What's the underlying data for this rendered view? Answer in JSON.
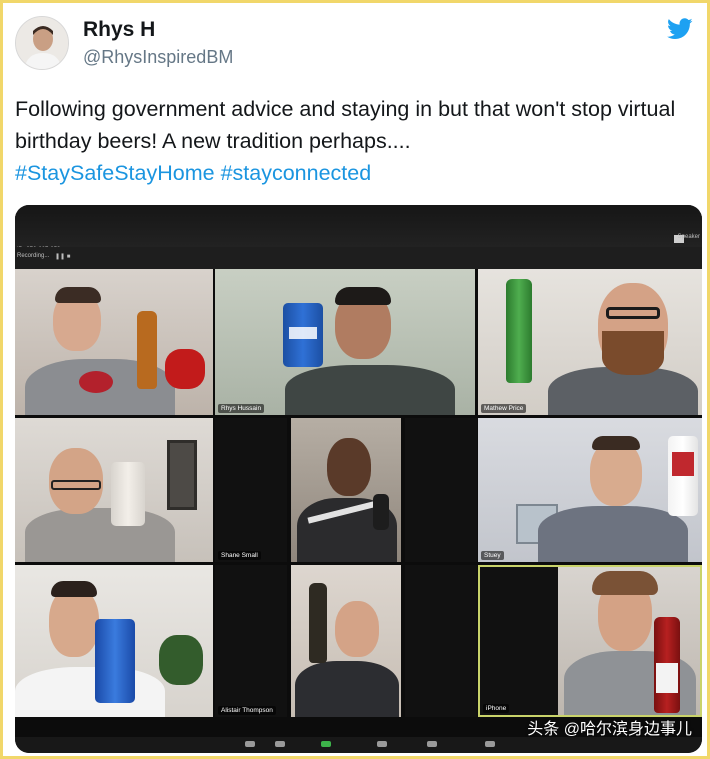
{
  "author": {
    "display_name": "Rhys H",
    "handle": "@RhysInspiredBM",
    "avatar": "profile-photo",
    "brand_icon": "twitter-bird-icon",
    "brand_color": "#1da1f2"
  },
  "tweet": {
    "text": "Following government advice and staying in but that won't stop virtual birthday beers! A new tradition perhaps....",
    "hashtags": [
      "#StaySafeStayHome",
      "#stayconnected"
    ],
    "hashtag_color": "#1b95e0"
  },
  "photo": {
    "top_bar": {
      "meeting_id": "ID: 976-667-853",
      "recording": "Recording...",
      "speaker_label": "Speaker"
    },
    "participants": [
      {
        "name": "",
        "drink": "bottle"
      },
      {
        "name": "Rhys Hussain",
        "drink": "can"
      },
      {
        "name": "Mathew Price",
        "drink": "bottle"
      },
      {
        "name": "",
        "drink": "can"
      },
      {
        "name": "Shane Small",
        "drink": "can"
      },
      {
        "name": "Stuey",
        "drink": "can"
      },
      {
        "name": "",
        "drink": "can"
      },
      {
        "name": "Alistair Thompson",
        "drink": "bottle"
      },
      {
        "name": "iPhone",
        "drink": "bottle"
      }
    ],
    "watermark": "头条 @哈尔滨身边事儿"
  }
}
